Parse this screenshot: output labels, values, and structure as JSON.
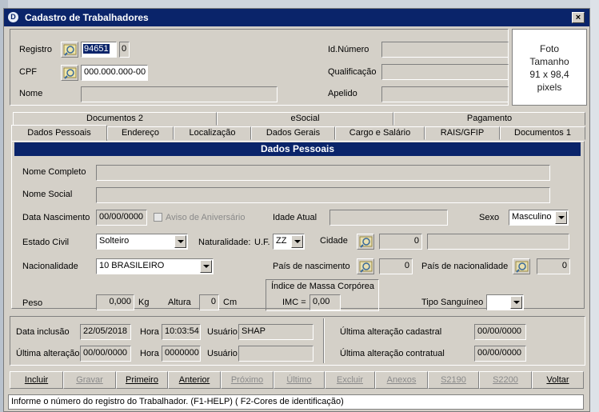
{
  "window": {
    "title": "Cadastro de Trabalhadores",
    "close_label": "×",
    "icon_letter": "D"
  },
  "header": {
    "registro_label": "Registro",
    "registro_value": "94651",
    "registro_digit": "0",
    "cpf_label": "CPF",
    "cpf_value": "000.000.000-00",
    "nome_label": "Nome",
    "nome_value": "",
    "id_numero_label": "Id.Número",
    "qualificacao_label": "Qualificação",
    "apelido_label": "Apelido",
    "photo_lines": [
      "Foto",
      "Tamanho",
      "91 x 98,4",
      "pixels"
    ]
  },
  "tabs_top": [
    "Documentos 2",
    "eSocial",
    "Pagamento"
  ],
  "tabs_bottom": [
    "Dados Pessoais",
    "Endereço",
    "Localização",
    "Dados Gerais",
    "Cargo e Salário",
    "RAIS/GFIP",
    "Documentos 1"
  ],
  "active_tab": "Dados Pessoais",
  "dados": {
    "section_title": "Dados Pessoais",
    "nome_completo_label": "Nome Completo",
    "nome_social_label": "Nome Social",
    "data_nasc_label": "Data Nascimento",
    "data_nasc_value": "00/00/0000",
    "aviso_label": "Aviso de Aniversário",
    "idade_label": "Idade Atual",
    "sexo_label": "Sexo",
    "sexo_value": "Masculino",
    "estado_civil_label": "Estado Civil",
    "estado_civil_value": "Solteiro",
    "naturalidade_label": "Naturalidade:",
    "uf_label": "U.F.",
    "uf_value": "ZZ",
    "cidade_label": "Cidade",
    "cidade_code": "0",
    "nacionalidade_label": "Nacionalidade",
    "nacionalidade_value": "10  BRASILEIRO",
    "pais_nasc_label": "País de nascimento",
    "pais_nasc_value": "0",
    "pais_nac_label": "País de nacionalidade",
    "pais_nac_value": "0",
    "imc_title": "Índice de Massa Corpórea",
    "imc_label": "IMC =",
    "imc_value": "0,00",
    "peso_label": "Peso",
    "peso_value": "0,000",
    "peso_unit": "Kg",
    "altura_label": "Altura",
    "altura_value": "0",
    "altura_unit": "Cm",
    "tipo_sang_label": "Tipo Sanguíneo",
    "tipo_sang_value": ""
  },
  "audit": {
    "data_inclusao_label": "Data inclusão",
    "data_inclusao_value": "22/05/2018",
    "hora_label": "Hora",
    "hora_inclusao_value": "10:03:54",
    "usuario_label": "Usuário",
    "usuario_value": "SHAP",
    "ultima_alt_label": "Última alteração",
    "ultima_alt_value": "00/00/0000",
    "hora_alt_value": "0000000",
    "usuario_alt_value": "",
    "ult_alt_cadastral_label": "Última alteração cadastral",
    "ult_alt_cadastral_value": "00/00/0000",
    "ult_alt_contratual_label": "Última alteração contratual",
    "ult_alt_contratual_value": "00/00/0000"
  },
  "buttons": [
    {
      "label": "Incluir",
      "enabled": true
    },
    {
      "label": "Gravar",
      "enabled": false
    },
    {
      "label": "Primeiro",
      "enabled": true
    },
    {
      "label": "Anterior",
      "enabled": true
    },
    {
      "label": "Próximo",
      "enabled": false
    },
    {
      "label": "Último",
      "enabled": false
    },
    {
      "label": "Excluir",
      "enabled": false
    },
    {
      "label": "Anexos",
      "enabled": false
    },
    {
      "label": "S2190",
      "enabled": false
    },
    {
      "label": "S2200",
      "enabled": false
    },
    {
      "label": "Voltar",
      "enabled": true
    }
  ],
  "status": "Informe o número do registro do Trabalhador.   (F1-HELP) ( F2-Cores de identificação)",
  "colors": {
    "title_bar": "#0a246a",
    "face": "#d4d0c8",
    "section_header": "#0a246a"
  }
}
